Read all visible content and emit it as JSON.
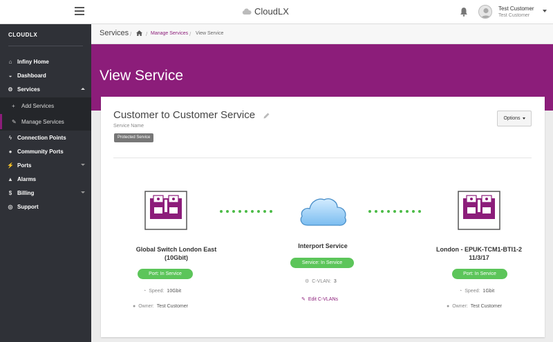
{
  "topbar": {
    "app_title": "CloudLX",
    "user_name": "Test Customer",
    "user_org": "Test Customer"
  },
  "sidebar": {
    "brand": "CLOUDLX",
    "items": [
      {
        "label": "Infiny Home",
        "icon": "home-icon"
      },
      {
        "label": "Dashboard",
        "icon": "dashboard-icon"
      },
      {
        "label": "Services",
        "icon": "cogs-icon"
      },
      {
        "label": "Connection Points",
        "icon": "bolt-icon"
      },
      {
        "label": "Community Ports",
        "icon": "users-icon"
      },
      {
        "label": "Ports",
        "icon": "plug-icon"
      },
      {
        "label": "Alarms",
        "icon": "bell-icon"
      },
      {
        "label": "Billing",
        "icon": "dollar-icon"
      },
      {
        "label": "Support",
        "icon": "lifebuoy-icon"
      }
    ],
    "sub_items": [
      {
        "label": "Add Services",
        "icon": "plus-icon"
      },
      {
        "label": "Manage Services",
        "icon": "wrench-icon"
      }
    ]
  },
  "breadcrumb": {
    "title": "Services",
    "manage": "Manage Services",
    "current": "View Service"
  },
  "banner": {
    "title": "View Service"
  },
  "service": {
    "name": "Customer to Customer Service",
    "subtitle": "Service Name",
    "badge": "Protected Service",
    "options_label": "Options"
  },
  "endpoint_a": {
    "name_line1": "Global Switch London East",
    "name_line2": "(10Gbit)",
    "status": "Port: In Service",
    "speed_label": "Speed:",
    "speed": "10Gbit",
    "owner_label": "Owner:",
    "owner": "Test Customer"
  },
  "middle": {
    "name": "Interport Service",
    "status": "Service: In Service",
    "cvlan_label": "C-VLAN:",
    "cvlan": "3",
    "edit_label": "Edit C-VLANs"
  },
  "endpoint_b": {
    "name_line1": "London - EPUK-TCM1-BTI1-2",
    "name_line2": "11/3/17",
    "status": "Port: In Service",
    "speed_label": "Speed:",
    "speed": "1Gbit",
    "owner_label": "Owner:",
    "owner": "Test Customer"
  },
  "colors": {
    "accent": "#8c1d7a",
    "sidebar": "#2f3137",
    "status_green": "#5cc55a",
    "link_green": "#4cbb47"
  }
}
